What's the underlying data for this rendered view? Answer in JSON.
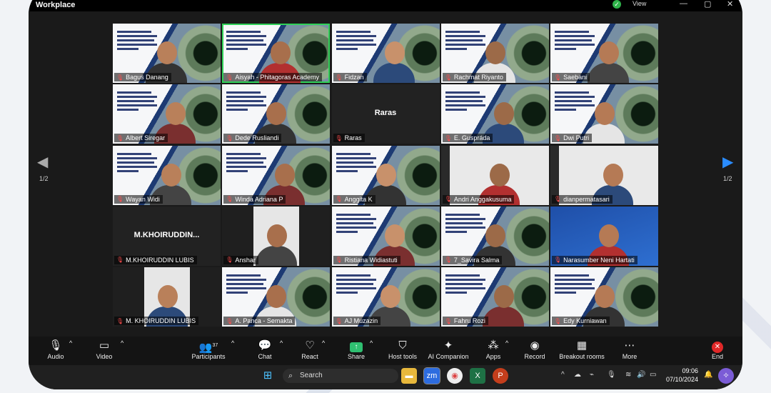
{
  "app": {
    "title": "Workplace",
    "view_label": "View"
  },
  "pagination": {
    "left": "1/2",
    "right": "1/2"
  },
  "participants": [
    {
      "name": "Bagus Danang",
      "style": "slide"
    },
    {
      "name": "Aisyah - Phitagoras Academy",
      "style": "slide",
      "active": true
    },
    {
      "name": "Fidzan",
      "style": "slide"
    },
    {
      "name": "Rachmat Riyanto",
      "style": "slide"
    },
    {
      "name": "Saebani",
      "style": "slide"
    },
    {
      "name": "Albert Siregar",
      "style": "slide"
    },
    {
      "name": "Dede Rusliandi",
      "style": "slide"
    },
    {
      "name": "Raras",
      "style": "plain",
      "center": "Raras"
    },
    {
      "name": "E. Guspráda",
      "style": "slide"
    },
    {
      "name": "Dwi Putri",
      "style": "slide"
    },
    {
      "name": "Wayan Widi",
      "style": "slide"
    },
    {
      "name": "Winda Adriana P",
      "style": "slide"
    },
    {
      "name": "Anggita K",
      "style": "slide"
    },
    {
      "name": "Andri Anggakusuma",
      "style": "photo"
    },
    {
      "name": "dianpermatasari",
      "style": "photo"
    },
    {
      "name": "M.KHOIRUDDIN LUBIS",
      "style": "plain",
      "center": "M.KHOIRUDDIN..."
    },
    {
      "name": "Anshar",
      "style": "photo-dark"
    },
    {
      "name": "Ristiana Widiastuti",
      "style": "slide"
    },
    {
      "name": "7_Savira Salma",
      "style": "slide"
    },
    {
      "name": "Narasumber Neni Hartati",
      "style": "blue"
    },
    {
      "name": "M. KHOIRUDDIN LUBIS",
      "style": "photo-dark"
    },
    {
      "name": "A. Panca - Semakta",
      "style": "slide"
    },
    {
      "name": "AJ Muzazin",
      "style": "slide"
    },
    {
      "name": "Fahru Rozi",
      "style": "slide"
    },
    {
      "name": "Edy Kurniawan",
      "style": "slide"
    }
  ],
  "toolbar": {
    "audio": "Audio",
    "video": "Video",
    "participants": "Participants",
    "participants_count": "37",
    "chat": "Chat",
    "react": "React",
    "share": "Share",
    "host_tools": "Host tools",
    "ai_companion": "AI Companion",
    "apps": "Apps",
    "record": "Record",
    "breakout": "Breakout rooms",
    "more": "More",
    "end": "End"
  },
  "taskbar": {
    "search_placeholder": "Search",
    "time": "09:06",
    "date": "07/10/2024"
  },
  "icons": {
    "mic": "microphone-icon",
    "video": "video-camera-icon",
    "participants": "people-icon",
    "chat": "chat-bubble-icon",
    "react": "heart-icon",
    "share": "share-screen-icon",
    "host": "shield-icon",
    "ai": "sparkle-icon",
    "apps": "apps-icon",
    "record": "record-icon",
    "breakout": "grid-icon",
    "more": "more-icon",
    "end": "end-icon"
  },
  "colors": {
    "active_border": "#30d158",
    "end": "#e02828",
    "share": "#2fbf71"
  }
}
